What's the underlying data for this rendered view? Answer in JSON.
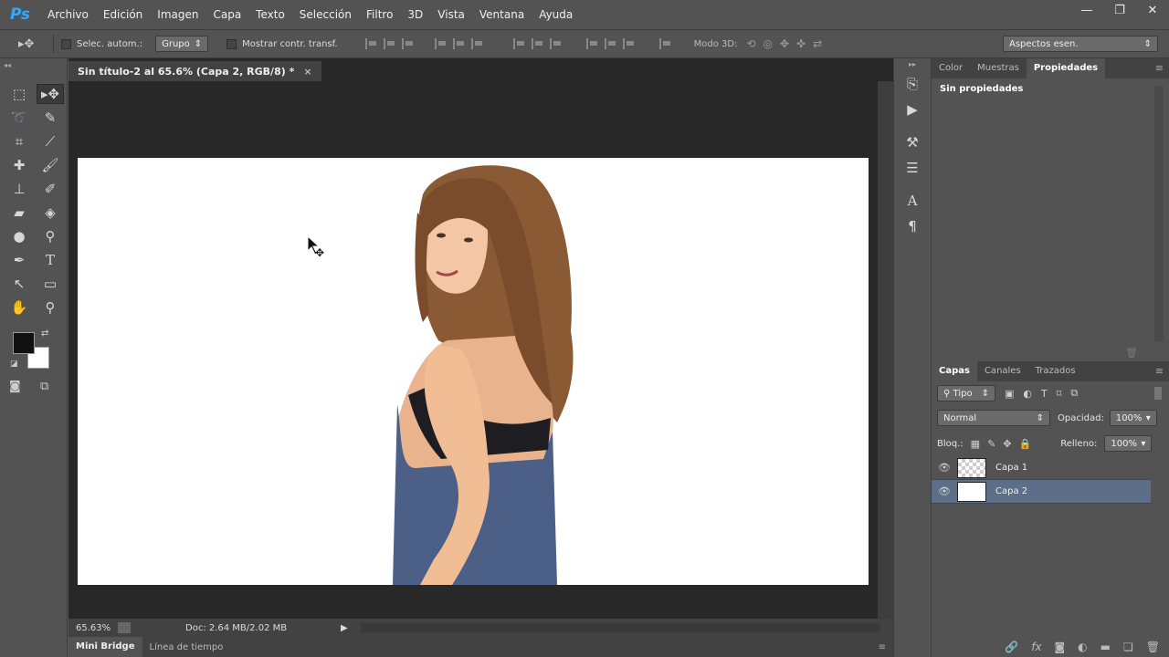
{
  "app": {
    "logo": "Ps"
  },
  "menu": [
    "Archivo",
    "Edición",
    "Imagen",
    "Capa",
    "Texto",
    "Selección",
    "Filtro",
    "3D",
    "Vista",
    "Ventana",
    "Ayuda"
  ],
  "window_controls": {
    "minimize": "—",
    "restore": "❐",
    "close": "✕"
  },
  "options_bar": {
    "auto_select_label": "Selec. autom.:",
    "auto_select_value": "Grupo",
    "show_transform_label": "Mostrar contr. transf.",
    "mode3d_label": "Modo 3D:",
    "workspace_value": "Aspectos esen."
  },
  "document": {
    "tab_title": "Sin título-2 al 65.6% (Capa 2, RGB/8) *",
    "tab_close": "×",
    "zoom": "65.63%",
    "doc_info": "Doc: 2.64 MB/2.02 MB"
  },
  "bottom_tabs": {
    "mini_bridge": "Mini Bridge",
    "timeline": "Línea de tiempo"
  },
  "properties_panel": {
    "tabs": [
      "Color",
      "Muestras",
      "Propiedades"
    ],
    "active_tab": "Propiedades",
    "content": "Sin propiedades"
  },
  "layers_panel": {
    "tabs": [
      "Capas",
      "Canales",
      "Trazados"
    ],
    "filter_value": "Tipo",
    "blend_mode": "Normal",
    "opacity_label": "Opacidad:",
    "opacity_value": "100%",
    "lock_label": "Bloq.:",
    "fill_label": "Relleno:",
    "fill_value": "100%",
    "layers": [
      {
        "name": "Capa 1",
        "selected": false
      },
      {
        "name": "Capa 2",
        "selected": true
      }
    ]
  },
  "colors": {
    "foreground": "#111111",
    "background": "#ffffff",
    "selection": "#5c6e88"
  }
}
